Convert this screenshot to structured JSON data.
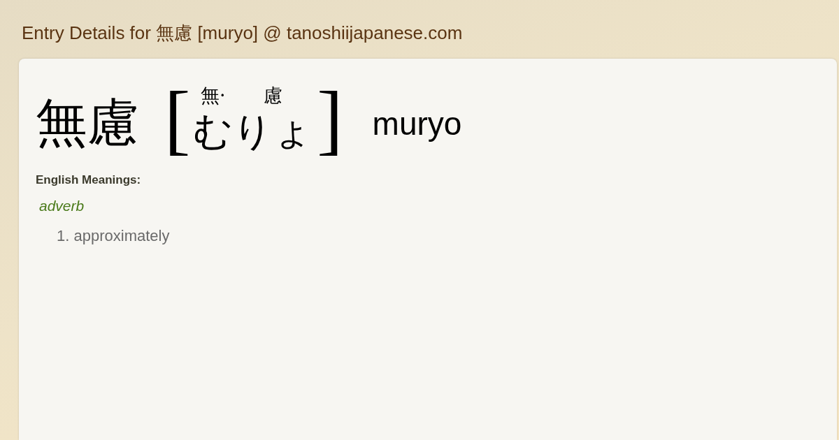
{
  "page_title": "Entry Details for 無慮 [muryo] @ tanoshiijapanese.com",
  "entry": {
    "word": "無慮",
    "open_bracket": "[",
    "close_bracket": "]",
    "reading": [
      {
        "kanji": "無·",
        "kana": "む"
      },
      {
        "kanji": "慮",
        "kana": "りょ"
      }
    ],
    "romaji": "muryo"
  },
  "meanings": {
    "label": "English Meanings:",
    "part_of_speech": "adverb",
    "senses": [
      {
        "number": "1.",
        "text": "approximately"
      }
    ]
  }
}
